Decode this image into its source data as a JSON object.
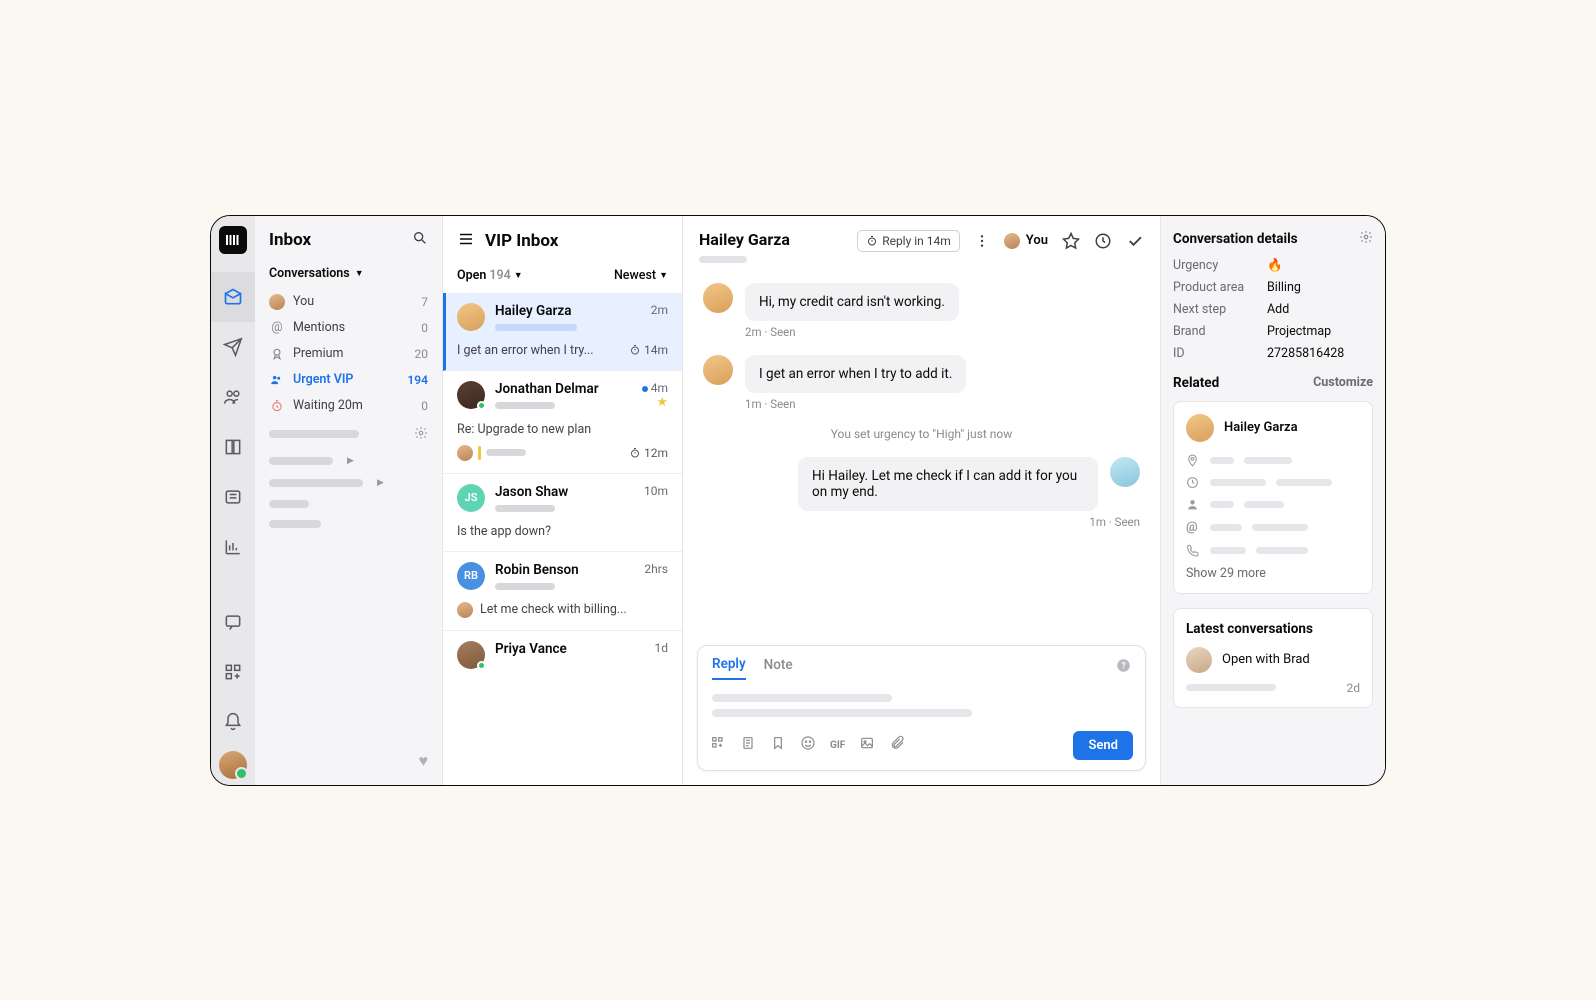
{
  "iconbar": {
    "tooltip_inbox": "Inbox"
  },
  "sidebar": {
    "title": "Inbox",
    "section": "Conversations",
    "items": [
      {
        "label": "You",
        "count": "7"
      },
      {
        "label": "Mentions",
        "count": "0"
      },
      {
        "label": "Premium",
        "count": "20"
      },
      {
        "label": "Urgent VIP",
        "count": "194"
      },
      {
        "label": "Waiting 20m",
        "count": "0"
      }
    ]
  },
  "list": {
    "title": "VIP Inbox",
    "filter_status": "Open",
    "filter_count": "194",
    "sort": "Newest",
    "items": [
      {
        "name": "Hailey Garza",
        "time": "2m",
        "preview": "I get an error when I try...",
        "sla": "14m"
      },
      {
        "name": "Jonathan Delmar",
        "time": "4m",
        "preview": "Re: Upgrade to new plan",
        "sla": "12m"
      },
      {
        "name": "Jason Shaw",
        "initials": "JS",
        "time": "10m",
        "preview": "Is the app down?"
      },
      {
        "name": "Robin Benson",
        "initials": "RB",
        "time": "2hrs",
        "preview": "Let me check with billing..."
      },
      {
        "name": "Priya Vance",
        "time": "1d"
      }
    ]
  },
  "thread": {
    "name": "Hailey Garza",
    "sla_pill": "Reply in 14m",
    "assignee": "You",
    "messages": [
      {
        "from": "them",
        "text": "Hi, my credit card isn't working.",
        "meta": "2m · Seen"
      },
      {
        "from": "them",
        "text": "I get an error when I try to add it.",
        "meta": "1m · Seen"
      }
    ],
    "system": "You set urgency to \"High\" just now",
    "reply": {
      "text": "Hi Hailey. Let me check if I can add it for you on my end.",
      "meta": "1m · Seen"
    }
  },
  "composer": {
    "tab_reply": "Reply",
    "tab_note": "Note",
    "gif": "GIF",
    "send": "Send"
  },
  "details": {
    "title": "Conversation details",
    "rows": [
      {
        "k": "Urgency",
        "v": "🔥"
      },
      {
        "k": "Product area",
        "v": "Billing"
      },
      {
        "k": "Next step",
        "v": "Add"
      },
      {
        "k": "Brand",
        "v": "Projectmap"
      },
      {
        "k": "ID",
        "v": "27285816428"
      }
    ],
    "related_title": "Related",
    "customize": "Customize",
    "related_name": "Hailey Garza",
    "show_more": "Show 29 more",
    "latest_title": "Latest conversations",
    "latest_item": "Open with Brad",
    "latest_time": "2d"
  }
}
